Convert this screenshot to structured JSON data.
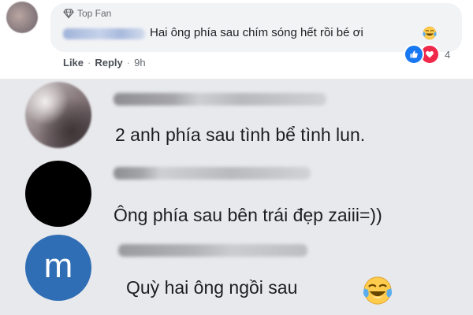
{
  "top_comment": {
    "badge_label": "Top Fan",
    "badge_icon": "diamond-icon",
    "text": "Hai ông phía sau chím sóng hết rồi bé ơi",
    "emoji": "laughing-tears-emoji",
    "actions": {
      "like": "Like",
      "reply": "Reply",
      "time": "9h",
      "separator": "·"
    },
    "reactions": {
      "icons": [
        "like-reaction-icon",
        "love-reaction-icon"
      ],
      "count": "4"
    }
  },
  "replies": [
    {
      "avatar": "photo-avatar",
      "text": "2 anh phía sau  tình bể tình lun."
    },
    {
      "avatar": "black-avatar",
      "text": "Ông phía sau bên trái đẹp zaiii=))"
    },
    {
      "avatar_letter": "m",
      "text": "Quỳ hai ông ngồi sau",
      "emoji": "laughing-tears-emoji"
    }
  ],
  "colors": {
    "like_blue": "#1877f2",
    "love_red": "#f02849",
    "avatar_blue": "#2f6db5",
    "emoji_yellow": "#ffcc4d"
  }
}
